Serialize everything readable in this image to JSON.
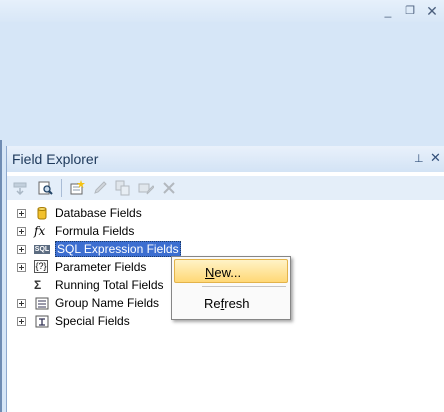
{
  "window": {
    "minimize_glyph": "_",
    "restore_glyph": "❐",
    "close_glyph": "✕"
  },
  "panel": {
    "title": "Field Explorer",
    "pin_glyph": "⊥",
    "close_glyph": "✕"
  },
  "toolbar": {
    "buttons": [
      {
        "icon": "insert-to-report-icon",
        "enabled": false
      },
      {
        "icon": "browse-icon",
        "enabled": true
      },
      {
        "icon": "new-icon",
        "enabled": true
      },
      {
        "icon": "edit-icon",
        "enabled": false
      },
      {
        "icon": "duplicate-icon",
        "enabled": false
      },
      {
        "icon": "rename-icon",
        "enabled": false
      },
      {
        "icon": "delete-icon",
        "enabled": false
      }
    ]
  },
  "tree": {
    "items": [
      {
        "label": "Database Fields",
        "icon": "database-icon",
        "expandable": true
      },
      {
        "label": "Formula Fields",
        "icon": "formula-icon",
        "icon_text": "fx",
        "expandable": true
      },
      {
        "label": "SQL Expression Fields",
        "icon": "sql-icon",
        "icon_text": "SQL",
        "expandable": true,
        "selected": true
      },
      {
        "label": "Parameter Fields",
        "icon": "parameter-icon",
        "icon_text": "{?}",
        "expandable": true
      },
      {
        "label": "Running Total Fields",
        "icon": "running-total-icon",
        "icon_text": "Σ",
        "expandable": false
      },
      {
        "label": "Group Name Fields",
        "icon": "group-name-icon",
        "expandable": true
      },
      {
        "label": "Special Fields",
        "icon": "special-fields-icon",
        "expandable": true
      }
    ]
  },
  "context_menu": {
    "items": [
      {
        "label": "New...",
        "accelerator": "N",
        "highlighted": true
      },
      {
        "label": "Refresh",
        "accelerator": "f",
        "highlighted": false
      }
    ]
  },
  "colors": {
    "selection": "#3c6ed0",
    "menu_highlight": "#ffd876",
    "panel_title": "#1e395b"
  }
}
